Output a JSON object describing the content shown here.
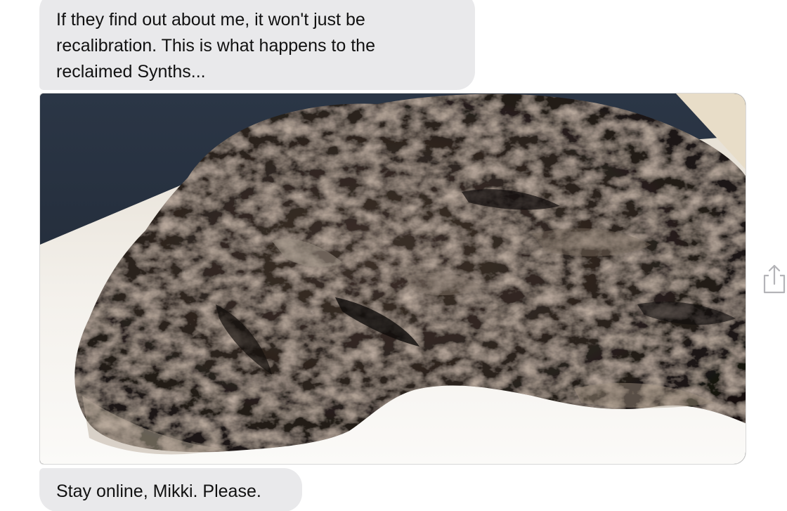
{
  "messages": [
    {
      "sender": "incoming",
      "type": "text",
      "lines": [
        "If they find out about me, it won't just be",
        "recalibration. This is what happens to the",
        "reclaimed Synths..."
      ]
    },
    {
      "sender": "incoming",
      "type": "image",
      "subject": "charred-remains-photo"
    },
    {
      "sender": "incoming",
      "type": "text",
      "text": "Stay online, Mikki. Please."
    }
  ],
  "actions": {
    "share_icon": "share-icon"
  },
  "colors": {
    "bubble_bg": "#e9e9eb",
    "text": "#111111",
    "icon": "#b4b4b8"
  }
}
